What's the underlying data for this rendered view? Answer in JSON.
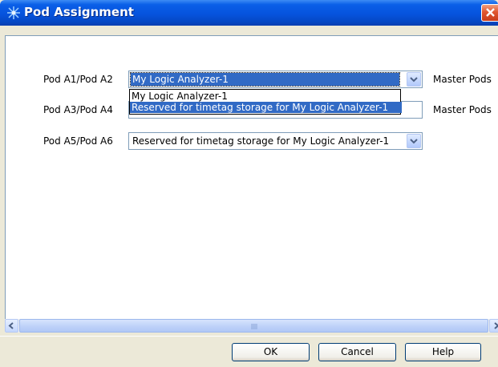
{
  "window": {
    "title": "Pod Assignment"
  },
  "pods": [
    {
      "label": "Pod A1/Pod A2",
      "value": "My Logic Analyzer-1",
      "master": "Master Pods"
    },
    {
      "label": "Pod A3/Pod A4",
      "value": "",
      "master": "Master Pods"
    },
    {
      "label": "Pod A5/Pod A6",
      "value": "Reserved for timetag storage for My Logic Analyzer-1",
      "master": ""
    }
  ],
  "dropdown": {
    "options": [
      "My Logic Analyzer-1",
      "Reserved for timetag storage for My Logic Analyzer-1"
    ],
    "selected_index": 1
  },
  "buttons": {
    "ok": "OK",
    "cancel": "Cancel",
    "help": "Help"
  },
  "icons": {
    "title": "logic-analyzer-app-icon",
    "close": "close-icon",
    "dropdown": "chevron-down-icon",
    "scroll_left": "arrow-left-icon",
    "scroll_right": "arrow-right-icon"
  },
  "colors": {
    "titlebar": "#0653dd",
    "selection": "#316ac5",
    "dialog_bg": "#ece9d8",
    "close_button": "#e0552f"
  }
}
